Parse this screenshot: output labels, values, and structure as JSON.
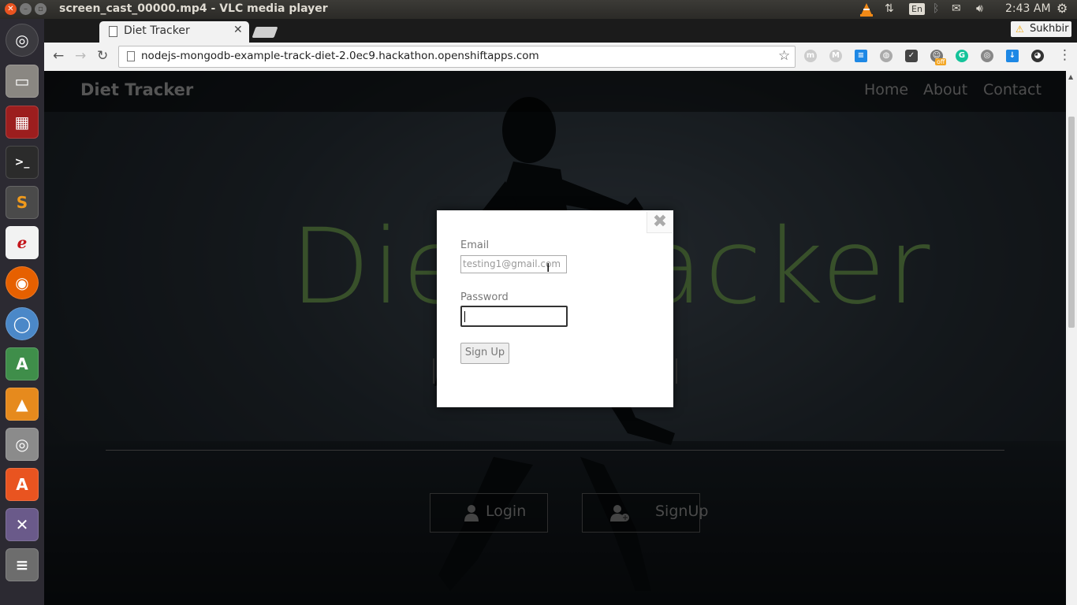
{
  "system": {
    "window_title": "screen_cast_00000.mp4 - VLC media player",
    "lang": "En",
    "time": "2:43 AM",
    "user": "Sukhbir"
  },
  "browser": {
    "tab_title": "Diet Tracker",
    "url": "nodejs-mongodb-example-track-diet-2.0ec9.hackathon.openshiftapps.com",
    "extensions": [
      "mercury-icon",
      "mercury-m-icon",
      "list-icon",
      "globe-icon",
      "pocket-icon",
      "ghostery-icon",
      "grammarly-icon",
      "tampermonkey-icon",
      "download-icon",
      "github-icon"
    ],
    "extension_badge": "off"
  },
  "page": {
    "brand": "Diet Tracker",
    "nav": {
      "home": "Home",
      "about": "About",
      "contact": "Contact"
    },
    "hero": "Diet Tracker",
    "login_label": "Login",
    "signup_label": "SignUp"
  },
  "modal": {
    "close_glyph": "✖",
    "email_label": "Email",
    "email_value": "testing1@gmail.com",
    "password_label": "Password",
    "submit_label": "Sign Up"
  },
  "colors": {
    "hero_text": "#38502a",
    "ubuntu_orange": "#e95420"
  }
}
